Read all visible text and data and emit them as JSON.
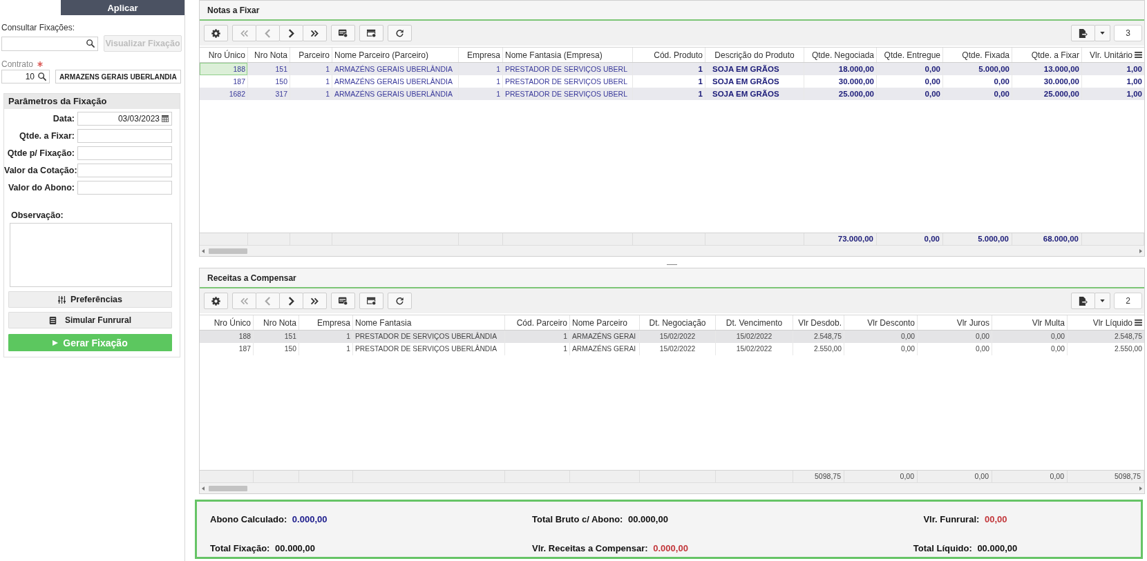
{
  "sidebar": {
    "apply_button": "Aplicar",
    "consult": {
      "label": "Consultar Fixações:",
      "view_button": {
        "label": "Visualizar Fixação",
        "disabled": true
      }
    },
    "contract": {
      "label": "Contrato",
      "required": true,
      "code": "10",
      "name": "ARMAZENS GERAIS UBERLANDIA"
    },
    "parameters": {
      "title": "Parâmetros da Fixação",
      "fields": [
        {
          "label": "Data:",
          "kind": "date",
          "value": "03/03/2023"
        },
        {
          "label": "Qtde. a Fixar:",
          "kind": "text"
        },
        {
          "label": "Qtde p/ Fixação:",
          "kind": "text"
        },
        {
          "label": "Valor da Cotação:",
          "kind": "text"
        },
        {
          "label": "Valor do Abono:",
          "kind": "text"
        }
      ],
      "note_label": "Observação:",
      "buttons": [
        {
          "label": "Preferências",
          "kind": "preferences"
        },
        {
          "label": "Simular Funrural",
          "kind": "simulate"
        },
        {
          "label": "Gerar Fixação",
          "kind": "generate"
        }
      ]
    }
  },
  "panels": [
    {
      "title": "Notas a Fixar",
      "toolbar": [
        {
          "buttons": [
            {
              "kind": "settings",
              "disabled": false
            }
          ]
        },
        {
          "buttons": [
            {
              "kind": "first",
              "disabled": true
            },
            {
              "kind": "previous",
              "disabled": true
            },
            {
              "kind": "next",
              "disabled": false
            },
            {
              "kind": "last",
              "disabled": false
            }
          ]
        },
        {
          "buttons": [
            {
              "kind": "card",
              "disabled": false
            }
          ]
        },
        {
          "buttons": [
            {
              "kind": "window",
              "disabled": false
            }
          ]
        },
        {
          "buttons": [
            {
              "kind": "refresh",
              "disabled": false
            }
          ]
        }
      ],
      "record_count": "3",
      "table": {
        "columns": [
          {
            "label": "Nro Único",
            "kind": "number"
          },
          {
            "label": "Nro Nota",
            "kind": "number"
          },
          {
            "label": "Parceiro",
            "kind": "number"
          },
          {
            "label": "Nome Parceiro (Parceiro)",
            "kind": "text"
          },
          {
            "label": "Empresa",
            "kind": "number"
          },
          {
            "label": "Nome Fantasia (Empresa)",
            "kind": "text"
          },
          {
            "label": "Cód. Produto",
            "kind": "quantity"
          },
          {
            "label": "Descrição do Produto",
            "kind": "product"
          },
          {
            "label": "Qtde. Negociada",
            "kind": "quantity",
            "total": "73.000,00"
          },
          {
            "label": "Qtde. Entregue",
            "kind": "quantity",
            "total": "0,00"
          },
          {
            "label": "Qtde. Fixada",
            "kind": "quantity",
            "total": "5.000,00"
          },
          {
            "label": "Qtde. a Fixar",
            "kind": "quantity",
            "total": "68.000,00"
          },
          {
            "label": "Vlr. Unitário",
            "kind": "quantity"
          }
        ],
        "rows": [
          {
            "selected": true,
            "cells": [
              "188",
              "151",
              "1",
              "ARMAZÉNS GERAIS UBERLÂNDIA",
              "1",
              "PRESTADOR DE SERVIÇOS UBERL",
              "1",
              "SOJA EM GRÃOS",
              "18.000,00",
              "0,00",
              "5.000,00",
              "13.000,00",
              "1,00"
            ]
          },
          {
            "selected": false,
            "cells": [
              "187",
              "150",
              "1",
              "ARMAZÉNS GERAIS UBERLÂNDIA",
              "1",
              "PRESTADOR DE SERVIÇOS UBERL",
              "1",
              "SOJA EM GRÃOS",
              "30.000,00",
              "0,00",
              "0,00",
              "30.000,00",
              "1,00"
            ]
          },
          {
            "selected": false,
            "cells": [
              "1682",
              "317",
              "1",
              "ARMAZÉNS GERAIS UBERLÂNDIA",
              "1",
              "PRESTADOR DE SERVIÇOS UBERL",
              "1",
              "SOJA EM GRÃOS",
              "25.000,00",
              "0,00",
              "0,00",
              "25.000,00",
              "1,00"
            ]
          }
        ]
      }
    },
    {
      "title": "Receitas a Compensar",
      "toolbar": [
        {
          "buttons": [
            {
              "kind": "settings",
              "disabled": false
            }
          ]
        },
        {
          "buttons": [
            {
              "kind": "first",
              "disabled": true
            },
            {
              "kind": "previous",
              "disabled": true
            },
            {
              "kind": "next",
              "disabled": false
            },
            {
              "kind": "last",
              "disabled": false
            }
          ]
        },
        {
          "buttons": [
            {
              "kind": "card",
              "disabled": false
            }
          ]
        },
        {
          "buttons": [
            {
              "kind": "window",
              "disabled": false
            }
          ]
        },
        {
          "buttons": [
            {
              "kind": "refresh",
              "disabled": false
            }
          ]
        }
      ],
      "record_count": "2",
      "table": {
        "columns": [
          {
            "label": "Nro Único",
            "kind": "number"
          },
          {
            "label": "Nro Nota",
            "kind": "number"
          },
          {
            "label": "Empresa",
            "kind": "number"
          },
          {
            "label": "Nome Fantasia",
            "kind": "text"
          },
          {
            "label": "Cód. Parceiro",
            "kind": "number"
          },
          {
            "label": "Nome Parceiro",
            "kind": "text"
          },
          {
            "label": "Dt. Negociação",
            "kind": "date"
          },
          {
            "label": "Dt. Vencimento",
            "kind": "date"
          },
          {
            "label": "Vlr Desdob.",
            "kind": "money",
            "total": "5098,75"
          },
          {
            "label": "Vlr Desconto",
            "kind": "money",
            "total": "0,00"
          },
          {
            "label": "Vlr Juros",
            "kind": "money",
            "total": "0,00"
          },
          {
            "label": "Vlr Multa",
            "kind": "money",
            "total": "0,00"
          },
          {
            "label": "Vlr Líquido",
            "kind": "money",
            "total": "5098,75"
          }
        ],
        "rows": [
          {
            "selected": false,
            "cells": [
              "188",
              "151",
              "1",
              "PRESTADOR DE SERVIÇOS UBERLÂNDIA",
              "1",
              "ARMAZÉNS GERAI",
              "15/02/2022",
              "15/02/2022",
              "2.548,75",
              "0,00",
              "0,00",
              "0,00",
              "2.548,75"
            ]
          },
          {
            "selected": false,
            "cells": [
              "187",
              "150",
              "1",
              "PRESTADOR DE SERVIÇOS UBERLÂNDIA",
              "1",
              "ARMAZÉNS GERAI",
              "15/02/2022",
              "15/02/2022",
              "2.550,00",
              "0,00",
              "0,00",
              "0,00",
              "2.550,00"
            ]
          }
        ]
      }
    }
  ],
  "summary": [
    {
      "label": "Abono Calculado:",
      "value": "0.000,00",
      "color": "#1c1c8c"
    },
    {
      "label": "Total Bruto c/ Abono:",
      "value": "00.000,00",
      "color": "#111111"
    },
    {
      "label": "Vlr. Funrural:",
      "value": "00,00",
      "color": "#c2373b"
    },
    {
      "label": "Total Fixação:",
      "value": "00.000,00",
      "color": "#111111"
    },
    {
      "label": "Vlr. Receitas a Compensar:",
      "value": "0.000,00",
      "color": "#c2373b"
    },
    {
      "label": "Total Líquido:",
      "value": "00.000,00",
      "color": "#111111"
    }
  ]
}
